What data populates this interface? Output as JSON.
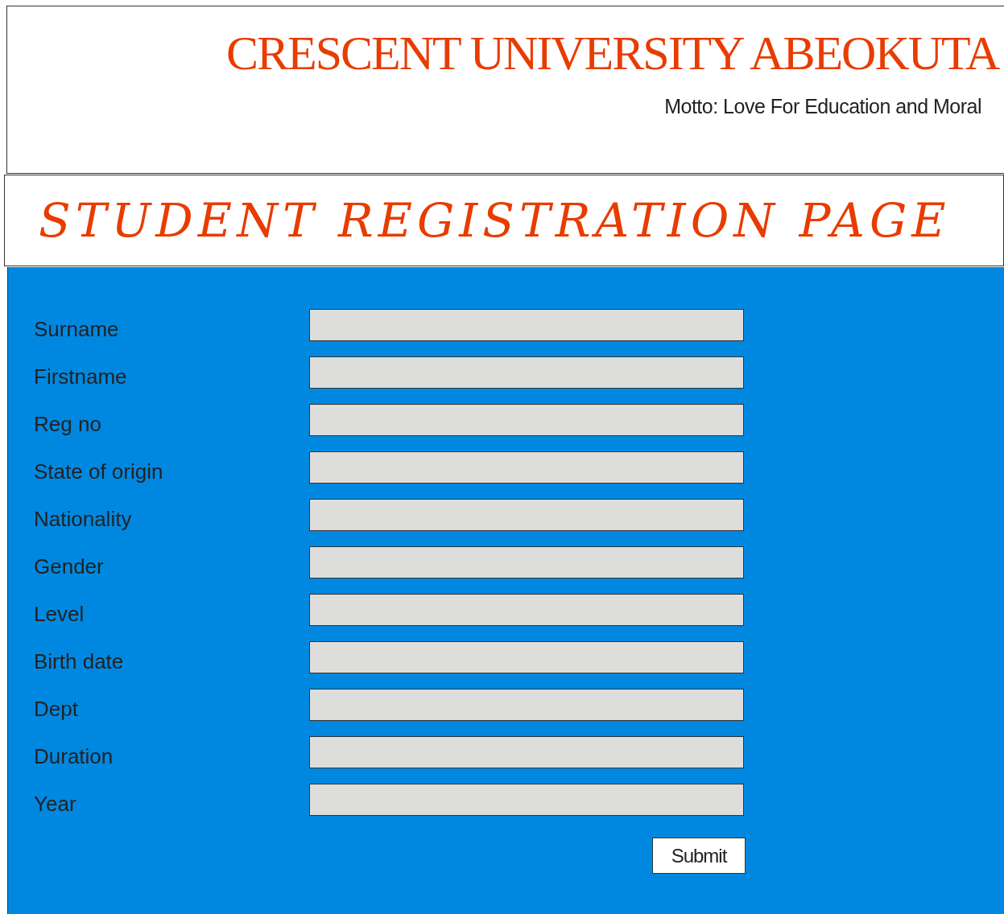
{
  "header": {
    "title": "CRESCENT UNIVERSITY ABEOKUTA",
    "motto": "Motto: Love For Education and Moral"
  },
  "page_title": "STUDENT REGISTRATION PAGE",
  "form": {
    "fields": [
      {
        "label": "Surname"
      },
      {
        "label": "Firstname"
      },
      {
        "label": "Reg no"
      },
      {
        "label": "State of origin"
      },
      {
        "label": "Nationality"
      },
      {
        "label": "Gender"
      },
      {
        "label": "Level"
      },
      {
        "label": "Birth date"
      },
      {
        "label": "Dept"
      },
      {
        "label": "Duration"
      },
      {
        "label": "Year"
      }
    ],
    "submit": "Submit"
  }
}
